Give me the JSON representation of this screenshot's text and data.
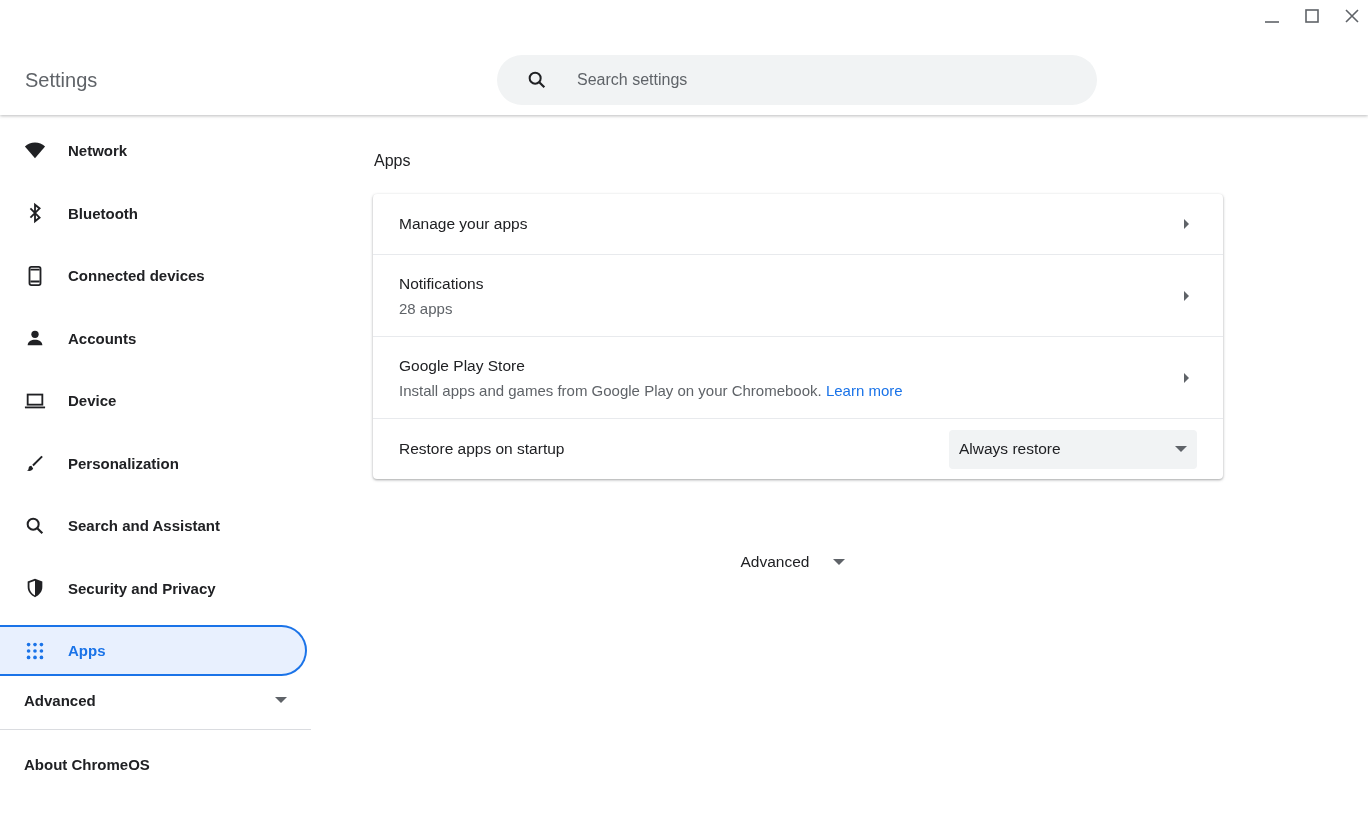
{
  "window": {
    "title": "Settings"
  },
  "search": {
    "placeholder": "Search settings"
  },
  "sidebar": {
    "items": [
      {
        "kind": "wifi",
        "label": "Network",
        "selected": false
      },
      {
        "kind": "bluetooth",
        "label": "Bluetooth",
        "selected": false
      },
      {
        "kind": "phone",
        "label": "Connected devices",
        "selected": false
      },
      {
        "kind": "person",
        "label": "Accounts",
        "selected": false
      },
      {
        "kind": "laptop",
        "label": "Device",
        "selected": false
      },
      {
        "kind": "brush",
        "label": "Personalization",
        "selected": false
      },
      {
        "kind": "search",
        "label": "Search and Assistant",
        "selected": false
      },
      {
        "kind": "shield",
        "label": "Security and Privacy",
        "selected": false
      },
      {
        "kind": "grid",
        "label": "Apps",
        "selected": true
      }
    ],
    "advanced": {
      "label": "Advanced",
      "expanded": false
    },
    "about": "About ChromeOS"
  },
  "section": {
    "title": "Apps",
    "rows": [
      {
        "kind": "link",
        "title": "Manage your apps"
      },
      {
        "kind": "link",
        "title": "Notifications",
        "subtitle": "28 apps"
      },
      {
        "kind": "link",
        "title": "Google Play Store",
        "subtitle": "Install apps and games from Google Play on your Chromebook.",
        "link": "Learn more"
      },
      {
        "kind": "select",
        "title": "Restore apps on startup",
        "value": "Always restore"
      }
    ]
  },
  "advanced": {
    "label": "Advanced",
    "expanded": false
  }
}
